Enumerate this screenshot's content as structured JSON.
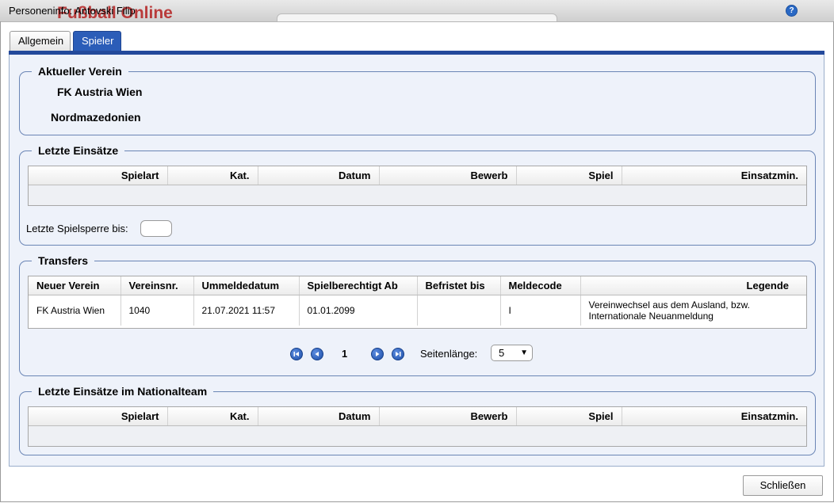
{
  "window": {
    "title": "Personeninfo: Antovski Filip",
    "background_logo": "Fußball Online",
    "help_icon": "question-icon"
  },
  "tabs": [
    {
      "label": "Allgemein",
      "active": false
    },
    {
      "label": "Spieler",
      "active": true
    }
  ],
  "aktueller_verein": {
    "legend": "Aktueller Verein",
    "club": "FK Austria Wien",
    "nationality": "Nordmazedonien"
  },
  "letzte_einsaetze": {
    "legend": "Letzte Einsätze",
    "columns": [
      "Spielart",
      "Kat.",
      "Datum",
      "Bewerb",
      "Spiel",
      "Einsatzmin."
    ],
    "rows": [],
    "spielsperre_label": "Letzte Spielsperre bis:",
    "spielsperre_value": ""
  },
  "transfers": {
    "legend": "Transfers",
    "columns": [
      "Neuer Verein",
      "Vereinsnr.",
      "Ummeldedatum",
      "Spielberechtigt Ab",
      "Befristet bis",
      "Meldecode",
      "Legende"
    ],
    "rows": [
      {
        "neuer_verein": "FK Austria Wien",
        "vereinsnr": "1040",
        "ummeldedatum": "21.07.2021 11:57",
        "spielberechtigt_ab": "01.01.2099",
        "befristet_bis": "",
        "meldecode": "I",
        "legende": "Vereinwechsel aus dem Ausland, bzw. Internationale Neuanmeldung"
      }
    ],
    "pager": {
      "current_page": "1",
      "page_size_label": "Seitenlänge:",
      "page_size": "5"
    }
  },
  "national_team": {
    "legend": "Letzte Einsätze im Nationalteam",
    "columns": [
      "Spielart",
      "Kat.",
      "Datum",
      "Bewerb",
      "Spiel",
      "Einsatzmin."
    ],
    "rows": []
  },
  "footer": {
    "close_label": "Schließen"
  },
  "colors": {
    "accent": "#2b5db8",
    "tab_strip": "#23499b",
    "panel_bg": "#eef2fa",
    "group_border": "#6a85b5",
    "logo_red": "#b42020"
  }
}
